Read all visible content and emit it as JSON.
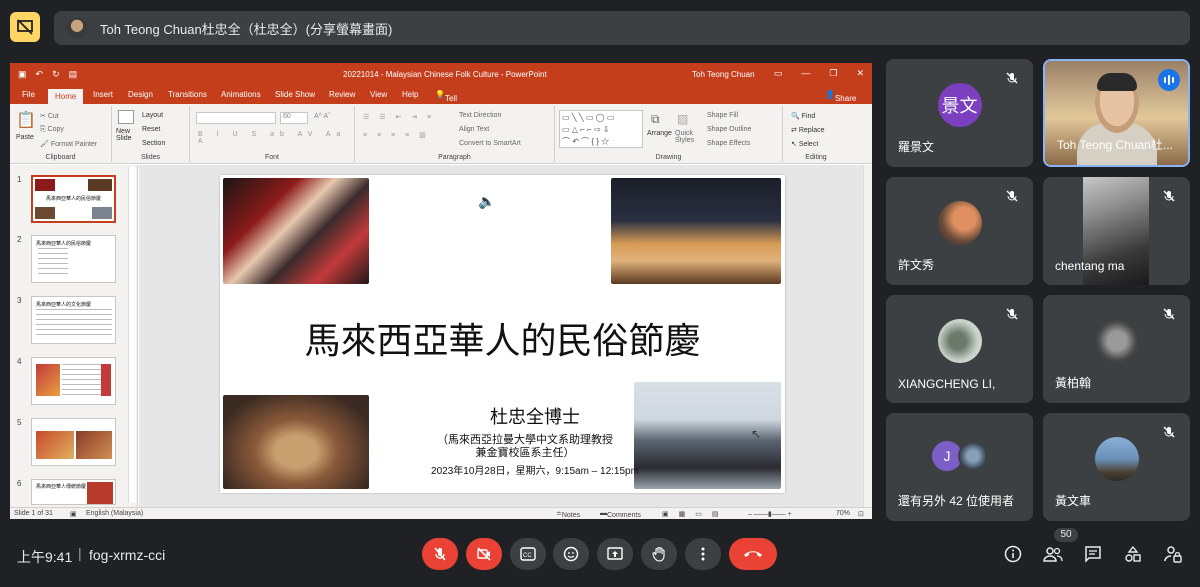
{
  "presenter_bar": {
    "label": "Toh Teong Chuan杜忠全（杜忠全）(分享螢幕畫面)"
  },
  "powerpoint": {
    "doc_title": "20221014 - Malaysian Chinese Folk Culture  -  PowerPoint",
    "user": "Toh Teong Chuan",
    "tabs": [
      "File",
      "Home",
      "Insert",
      "Design",
      "Transitions",
      "Animations",
      "Slide Show",
      "Review",
      "View",
      "Help",
      "Tell me what you want to do",
      "Share"
    ],
    "ribbon": {
      "clipboard": {
        "label": "Clipboard",
        "paste": "Paste",
        "cut": "Cut",
        "copy": "Copy",
        "format_painter": "Format Painter"
      },
      "slides": {
        "label": "Slides",
        "new_slide": "New Slide",
        "layout": "Layout",
        "reset": "Reset",
        "section": "Section"
      },
      "font": {
        "label": "Font",
        "size": "60"
      },
      "paragraph": {
        "label": "Paragraph",
        "text_direction": "Text Direction",
        "align_text": "Align Text",
        "convert": "Convert to SmartArt"
      },
      "drawing": {
        "label": "Drawing",
        "arrange": "Arrange",
        "quick_styles": "Quick Styles",
        "shape_fill": "Shape Fill",
        "shape_outline": "Shape Outline",
        "shape_effects": "Shape Effects"
      },
      "editing": {
        "label": "Editing",
        "find": "Find",
        "replace": "Replace",
        "select": "Select"
      }
    },
    "thumbnails": [
      {
        "num": "1",
        "title": "馬來西亞華人的民俗節慶"
      },
      {
        "num": "2",
        "title": "馬來西亞華人的民俗節慶"
      },
      {
        "num": "3",
        "title": "馬來西亞華人的文化節慶"
      },
      {
        "num": "4",
        "title": ""
      },
      {
        "num": "5",
        "title": ""
      },
      {
        "num": "6",
        "title": "馬來西亞華人傳統節慶"
      }
    ],
    "slide": {
      "title": "馬來西亞華人的民俗節慶",
      "author": "杜忠全博士",
      "affiliation_1": "（馬來西亞拉曼大學中文系助理教授",
      "affiliation_2": "兼金寶校區系主任）",
      "date": "2023年10月28日，星期六，9:15am – 12:15pm"
    },
    "status": {
      "slide_count": "Slide 1 of 31",
      "language": "English (Malaysia)",
      "notes": "Notes",
      "comments": "Comments",
      "zoom": "70%"
    },
    "accent_color": "#c43e1c"
  },
  "participants": [
    {
      "name": "羅景文",
      "avatar_text": "景文",
      "avatar_color": "#7b3fbf",
      "muted": true
    },
    {
      "name": "Toh Teong Chuan杜...",
      "video": true,
      "speaking": true
    },
    {
      "name": "許文秀",
      "muted": true
    },
    {
      "name": "chentang ma",
      "muted": true,
      "video": true
    },
    {
      "name": "XIANGCHENG LI,",
      "muted": true
    },
    {
      "name": "黃柏翰",
      "muted": true
    },
    {
      "name": "還有另外 42 位使用者",
      "avatar_text": "J"
    },
    {
      "name": "黃文車",
      "muted": true
    }
  ],
  "bottom_bar": {
    "time": "上午9:41",
    "separator": "|",
    "meeting_code": "fog-xrmz-cci",
    "people_count": "50"
  }
}
